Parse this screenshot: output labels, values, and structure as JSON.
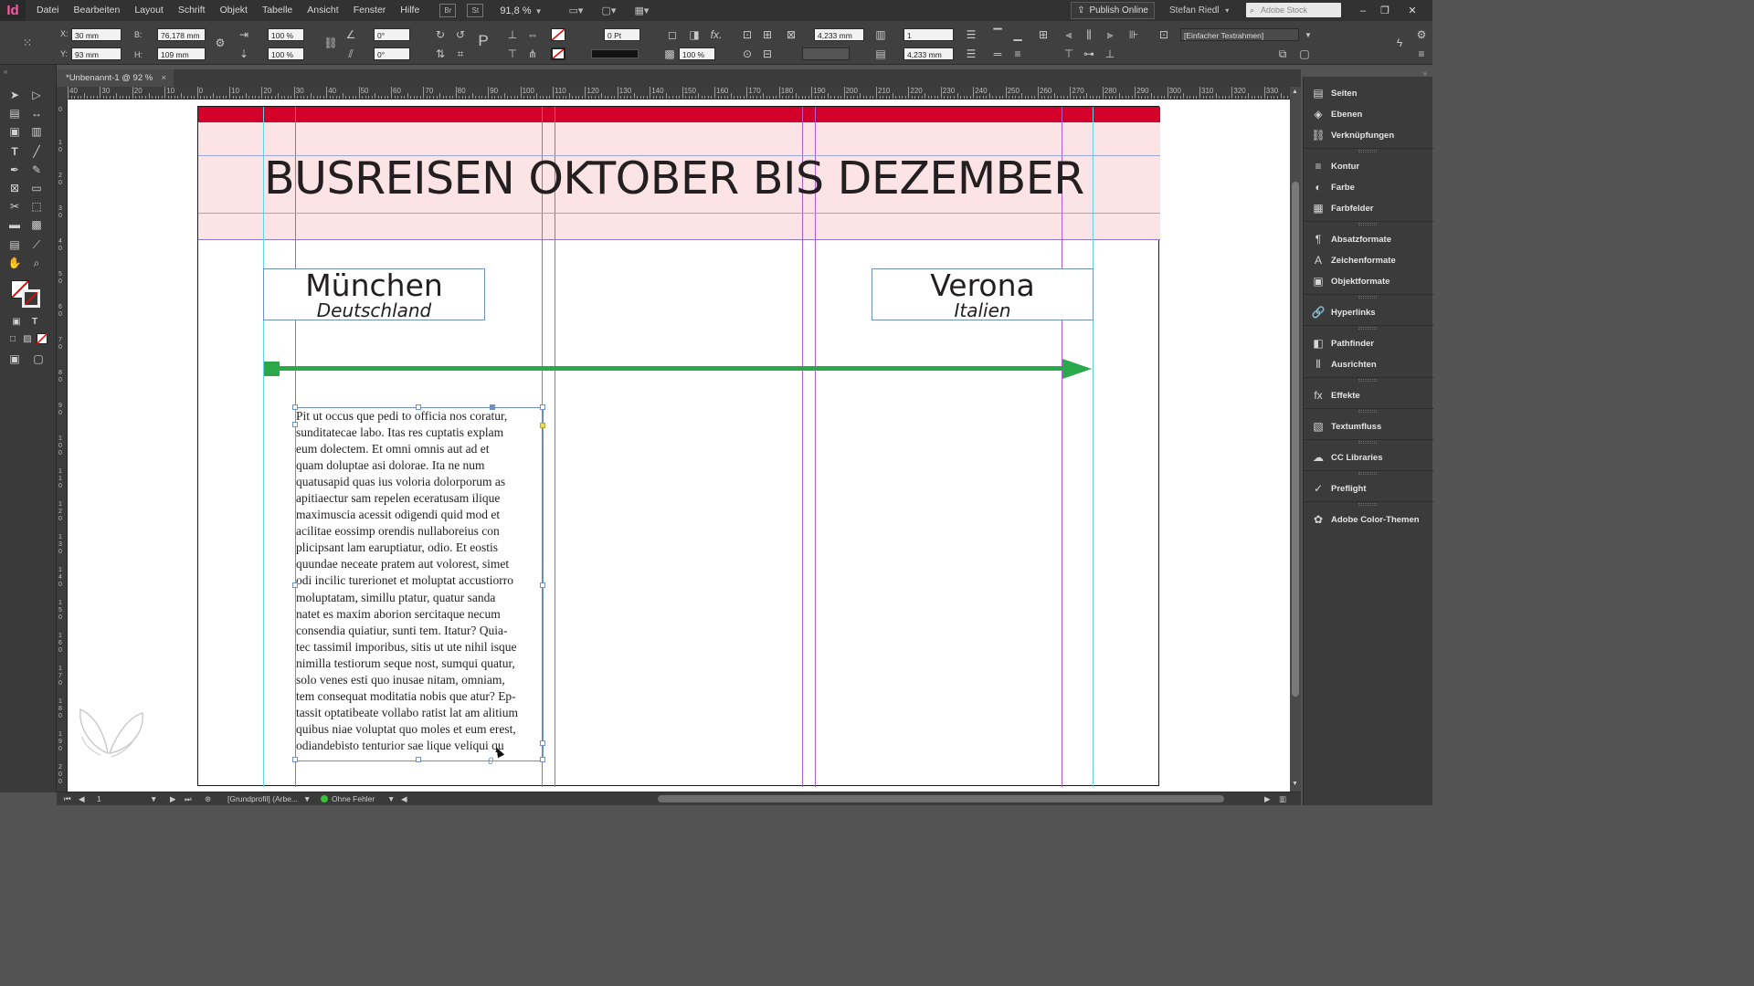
{
  "app": {
    "logo": "Id",
    "zoom": "91,8 %"
  },
  "menu": [
    "Datei",
    "Bearbeiten",
    "Layout",
    "Schrift",
    "Objekt",
    "Tabelle",
    "Ansicht",
    "Fenster",
    "Hilfe"
  ],
  "bridge_buttons": [
    "Br",
    "St"
  ],
  "publish_label": "Publish Online",
  "user_name": "Stefan Riedl",
  "stock_placeholder": "Adobe Stock",
  "window_controls": {
    "minimize": "–",
    "restore": "❐",
    "close": "✕"
  },
  "control": {
    "x_label": "X:",
    "x_value": "30 mm",
    "y_label": "Y:",
    "y_value": "93 mm",
    "w_label": "B:",
    "w_value": "76,178 mm",
    "h_label": "H:",
    "h_value": "109 mm",
    "scale_x": "100 %",
    "scale_y": "100 %",
    "rotate": "0°",
    "shear": "0°",
    "stroke_weight": "0 Pt",
    "opacity": "100 %",
    "offset_1": "4,233 mm",
    "offset_2": "4,233 mm",
    "columns": "1",
    "frame_style": "[Einfacher Textrahmen]"
  },
  "document_tab": {
    "title": "*Unbenannt-1 @ 92 %",
    "close": "×"
  },
  "ruler": {
    "top_labels": [
      "40",
      "30",
      "20",
      "10",
      "0",
      "10",
      "20",
      "30",
      "40",
      "50",
      "60",
      "70",
      "80",
      "90",
      "100",
      "110",
      "120",
      "130",
      "140",
      "150",
      "160",
      "170",
      "180",
      "190",
      "200",
      "210",
      "220",
      "230",
      "240",
      "250",
      "260",
      "270",
      "280",
      "290",
      "300",
      "310",
      "320",
      "330"
    ],
    "left_labels": [
      "0",
      "10",
      "20",
      "30",
      "40",
      "50",
      "60",
      "70",
      "80",
      "90",
      "100",
      "110",
      "120",
      "130",
      "140",
      "150",
      "160",
      "170",
      "180",
      "190",
      "200"
    ]
  },
  "document": {
    "title": "BUSREISEN OKTOBER BIS DEZEMBER",
    "city_left": {
      "name": "München",
      "country": "Deutschland"
    },
    "city_right": {
      "name": "Verona",
      "country": "Italien"
    },
    "body_lines": [
      "Pit ut occus que pedi to officia nos coratur,",
      "sunditatecae labo. Itas res cuptatis explam",
      "eum dolectem. Et omni omnis aut ad et",
      "quam doluptae asi dolorae. Ita ne num",
      "quatusapid quas ius voloria dolorporum as",
      "apitiaectur sam repelen eceratusam ilique",
      "maximuscia acessit odigendi quid mod et",
      "acilitae eossimp orendis nullaboreius con",
      "plicipsant lam earuptiatur, odio. Et eostis",
      "quundae neceate pratem aut volorest, simet",
      "odi incilic turerionet et moluptat accustiorro",
      "moluptatam, simillu ptatur, quatur sanda",
      "natet es maxim aborion sercitaque necum",
      "consendia quiatiur, sunti tem. Itatur? Quia-",
      "tec tassimil imporibus, sitis ut ute nihil isque",
      "nimilla testiorum seque nost, sumqui quatur,",
      "solo venes esti quo inusae nitam, omniam,",
      "tem consequat moditatia nobis que atur? Ep-",
      "tassit optatibeate vollabo ratist lat am alitium",
      "quibus niae voluptat quo moles et eum erest,",
      "odiandebisto tenturior sae lique veliqui qu"
    ],
    "overset": "0"
  },
  "status": {
    "page": "1",
    "profile": "[Grundprofil] (Arbe...",
    "preflight": "Ohne Fehler"
  },
  "panels": [
    {
      "label": "Seiten",
      "icon": "pages-icon",
      "glyph": "▤"
    },
    {
      "label": "Ebenen",
      "icon": "layers-icon",
      "glyph": "◈"
    },
    {
      "label": "Verknüpfungen",
      "icon": "links-icon",
      "glyph": "⛓"
    },
    {
      "label": "Kontur",
      "icon": "stroke-icon",
      "glyph": "≡"
    },
    {
      "label": "Farbe",
      "icon": "color-icon",
      "glyph": "◐"
    },
    {
      "label": "Farbfelder",
      "icon": "swatches-icon",
      "glyph": "▦"
    },
    {
      "label": "Absatzformate",
      "icon": "paragraph-styles-icon",
      "glyph": "¶"
    },
    {
      "label": "Zeichenformate",
      "icon": "character-styles-icon",
      "glyph": "A"
    },
    {
      "label": "Objektformate",
      "icon": "object-styles-icon",
      "glyph": "▣"
    },
    {
      "label": "Hyperlinks",
      "icon": "hyperlinks-icon",
      "glyph": "🔗"
    },
    {
      "label": "Pathfinder",
      "icon": "pathfinder-icon",
      "glyph": "◧"
    },
    {
      "label": "Ausrichten",
      "icon": "align-icon",
      "glyph": "⫴"
    },
    {
      "label": "Effekte",
      "icon": "effects-icon",
      "glyph": "fx"
    },
    {
      "label": "Textumfluss",
      "icon": "text-wrap-icon",
      "glyph": "▧"
    },
    {
      "label": "CC Libraries",
      "icon": "cc-libraries-icon",
      "glyph": "☁"
    },
    {
      "label": "Preflight",
      "icon": "preflight-icon",
      "glyph": "✓"
    },
    {
      "label": "Adobe Color-Themen",
      "icon": "color-themes-icon",
      "glyph": "✿"
    }
  ],
  "colors": {
    "header_red": "#d4002a",
    "header_pink": "#fbe3e6",
    "arrow_green": "#2aa84a",
    "frame_blue": "#6f8fc9"
  }
}
